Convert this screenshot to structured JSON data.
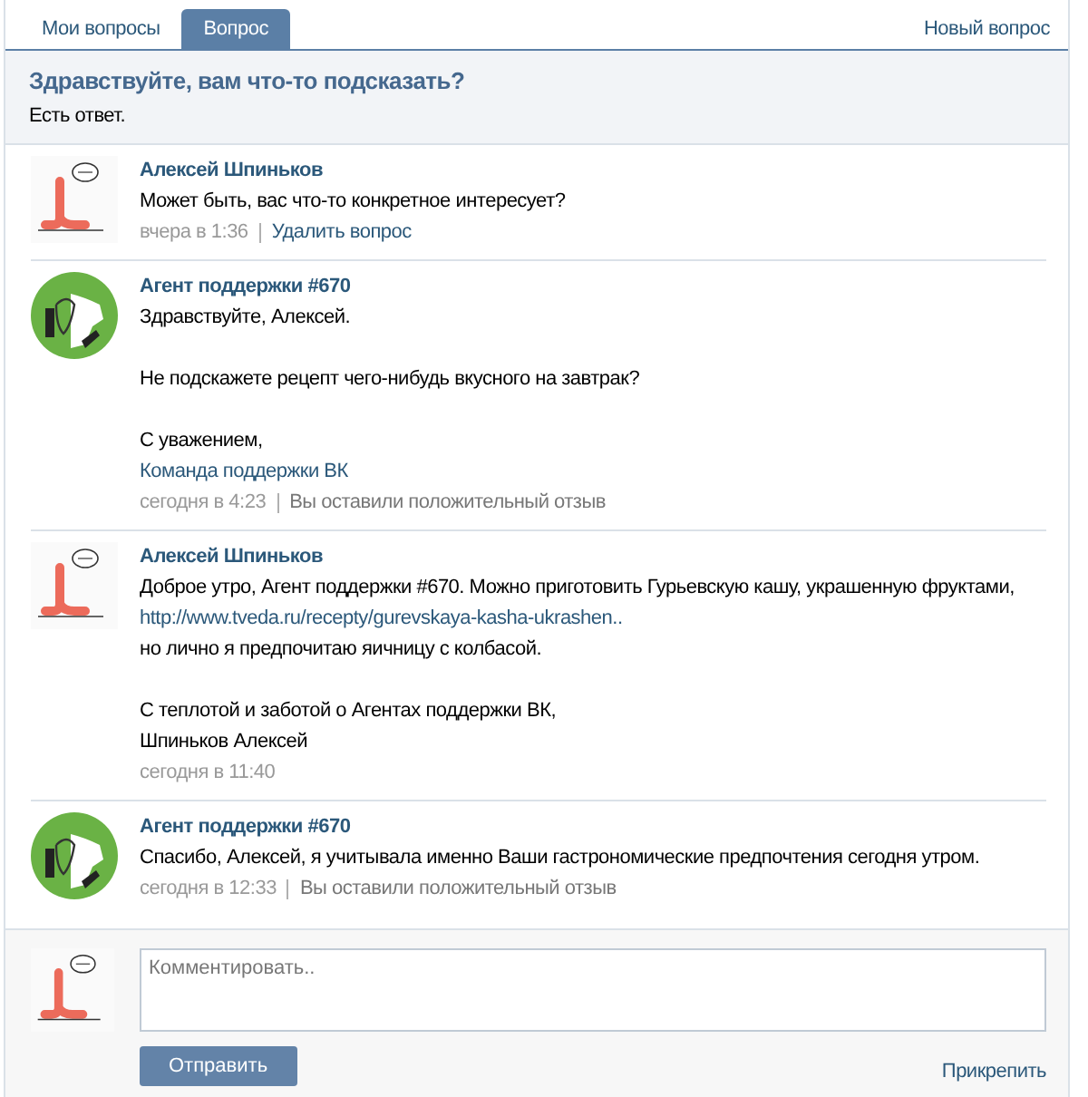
{
  "tabs": [
    {
      "label": "Мои вопросы",
      "selected": false
    },
    {
      "label": "Вопрос",
      "selected": true
    }
  ],
  "new_question_link": "Новый вопрос",
  "question": {
    "title": "Здравствуйте, вам что-то подсказать?",
    "status": "Есть ответ."
  },
  "messages": [
    {
      "kind": "user",
      "author": "Алексей Шпиньков",
      "paragraphs": [
        [
          {
            "kind": "text",
            "text": "Может быть, вас что-то конкретное интересует?"
          }
        ]
      ],
      "time": "вчера в 1:36",
      "action": {
        "kind": "link",
        "text": "Удалить вопрос"
      }
    },
    {
      "kind": "agent",
      "author": "Агент поддержки #670",
      "paragraphs": [
        [
          {
            "kind": "text",
            "text": "Здравствуйте, Алексей."
          }
        ],
        [
          {
            "kind": "text",
            "text": "Не подскажете рецепт чего-нибудь вкусного на завтрак?"
          }
        ],
        [
          {
            "kind": "text",
            "text": "С уважением,"
          },
          {
            "kind": "link",
            "text": "Команда поддержки ВК"
          }
        ]
      ],
      "time": "сегодня в 4:23",
      "action": {
        "kind": "note",
        "text": "Вы оставили положительный отзыв"
      }
    },
    {
      "kind": "user",
      "author": "Алексей Шпиньков",
      "paragraphs": [
        [
          {
            "kind": "text",
            "text": "Доброе утро, Агент поддержки #670. Можно приготовить Гурьевскую кашу, украшенную фруктами,"
          },
          {
            "kind": "link",
            "text": "http://www.tveda.ru/recepty/gurevskaya-kasha-ukrashen.."
          },
          {
            "kind": "text",
            "text": "но лично я предпочитаю яичницу с колбасой."
          }
        ],
        [
          {
            "kind": "text",
            "text": "С теплотой и заботой о Агентах поддержки ВК,"
          },
          {
            "kind": "text",
            "text": "Шпиньков Алексей"
          }
        ]
      ],
      "time": "сегодня в 11:40"
    },
    {
      "kind": "agent",
      "author": "Агент поддержки #670",
      "paragraphs": [
        [
          {
            "kind": "text",
            "text": "Спасибо, Алексей, я учитывала именно Ваши гастрономические предпочтения сегодня утром."
          }
        ]
      ],
      "time": "сегодня в 12:33",
      "action": {
        "kind": "note",
        "text": "Вы оставили положительный отзыв"
      }
    }
  ],
  "comment": {
    "placeholder": "Комментировать..",
    "send_button": "Отправить",
    "attach_link": "Прикрепить"
  }
}
